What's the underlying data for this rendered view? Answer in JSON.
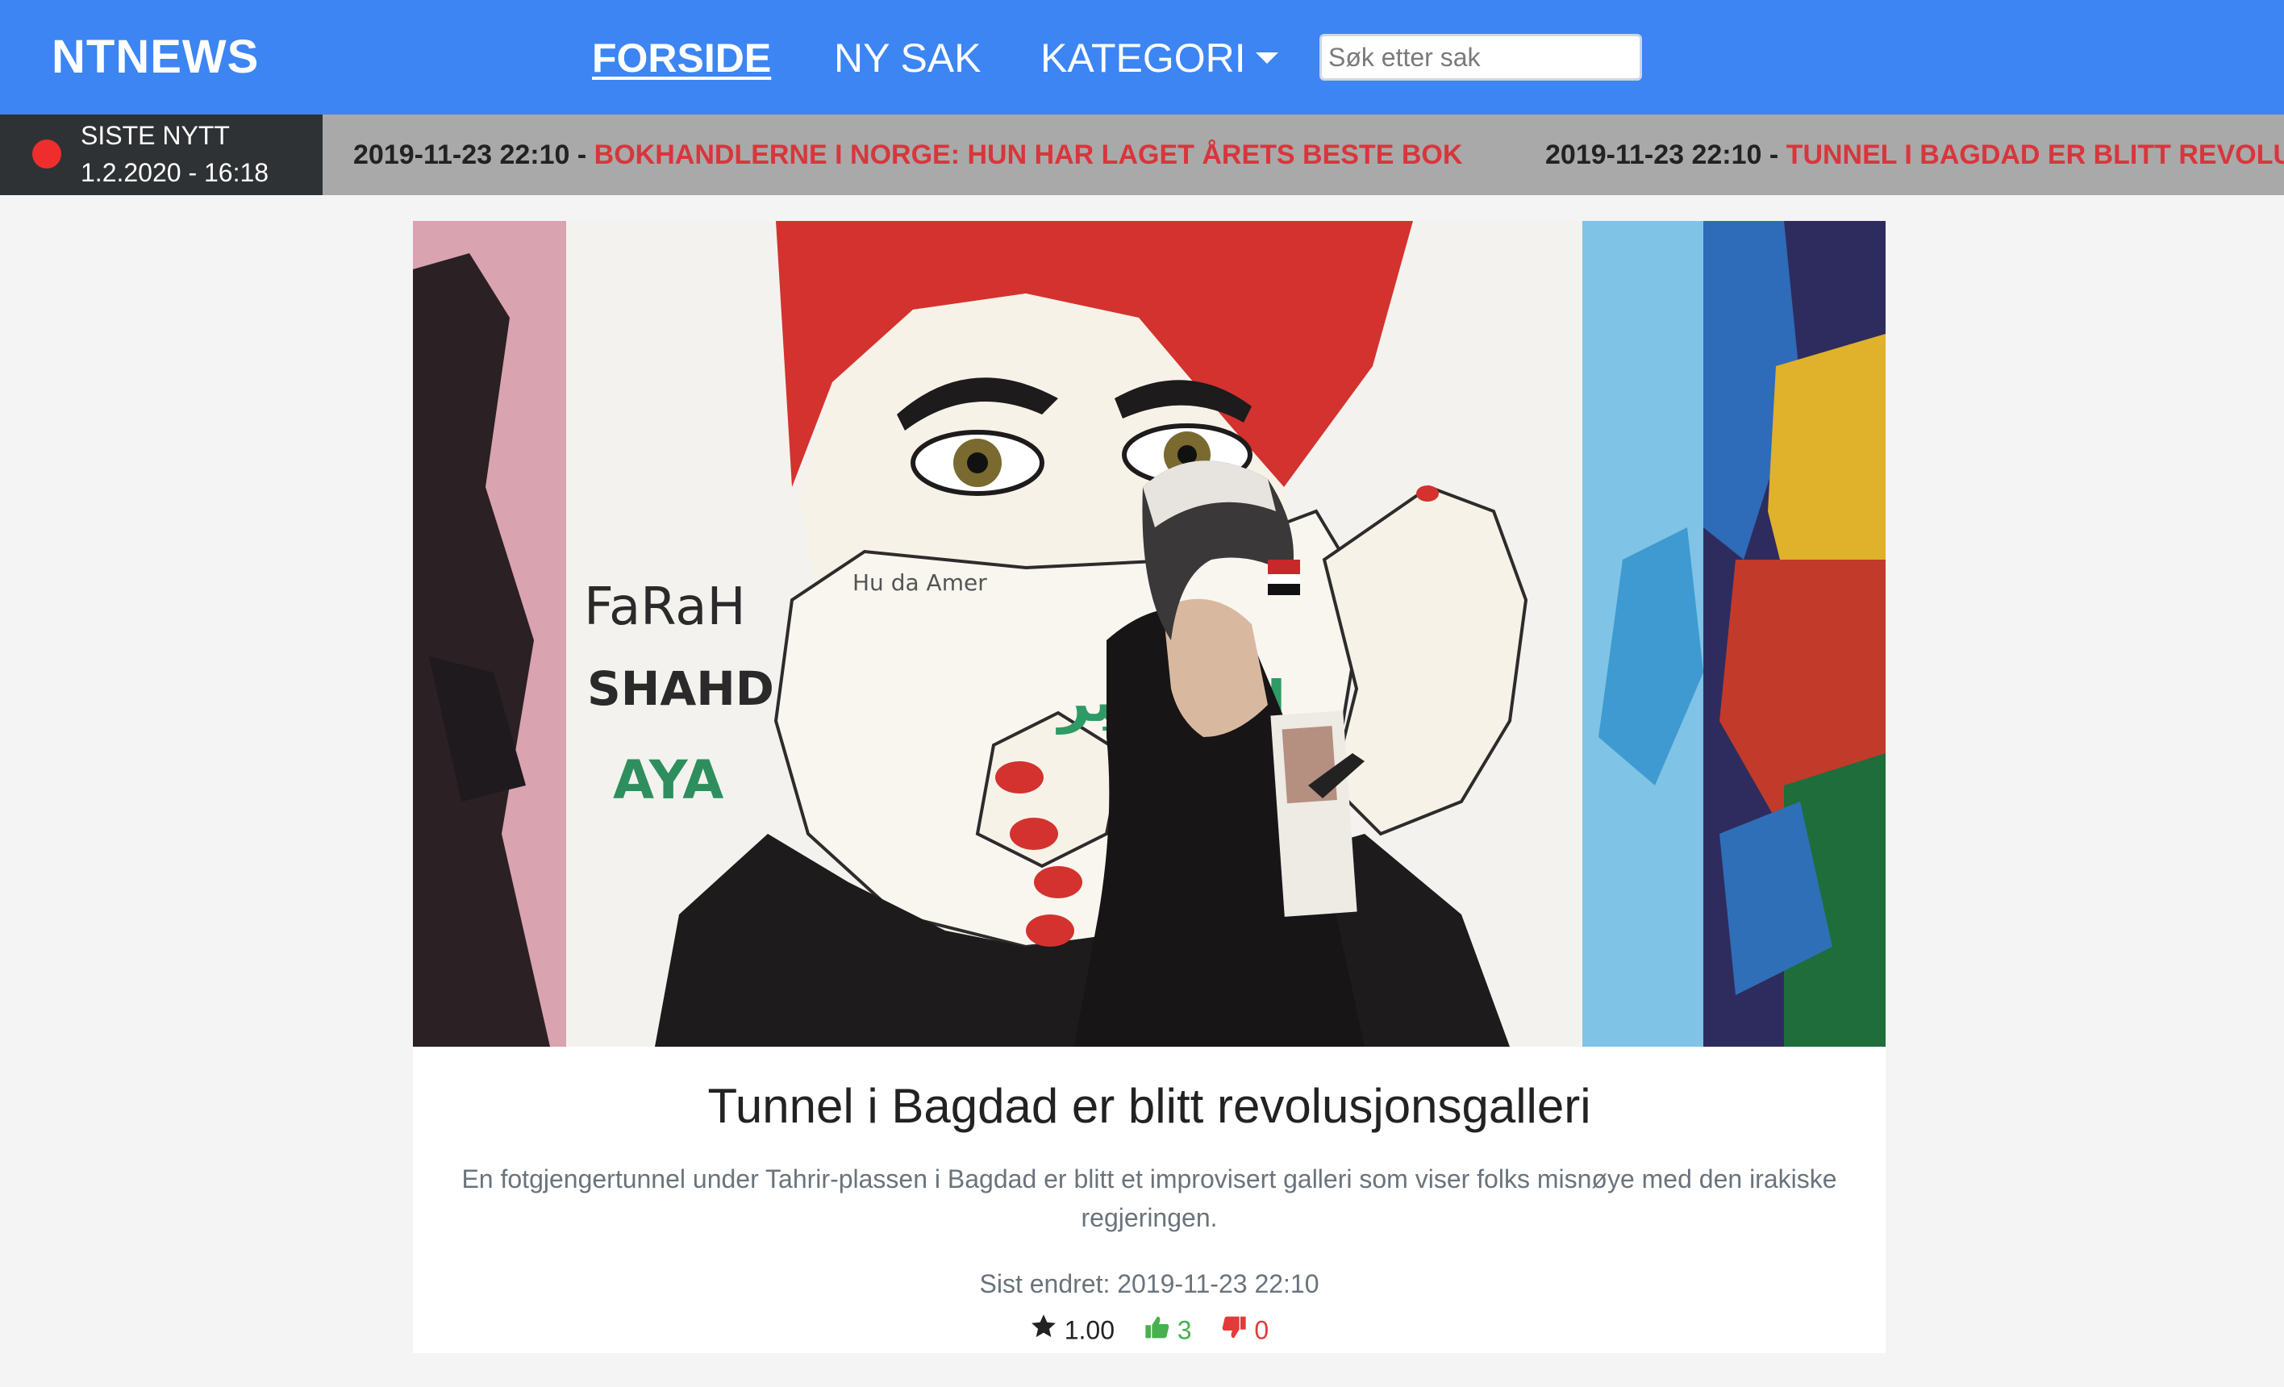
{
  "navbar": {
    "brand": "NTNEWS",
    "links": [
      {
        "label": "FORSIDE",
        "active": true
      },
      {
        "label": "NY SAK",
        "active": false
      },
      {
        "label": "KATEGORI",
        "active": false,
        "dropdown": true
      }
    ],
    "search_placeholder": "Søk etter sak",
    "colors": {
      "background": "#3c85f3",
      "text": "#ffffff"
    }
  },
  "ticker": {
    "label": "SISTE NYTT",
    "time": "1.2.2020 - 16:18",
    "items": [
      {
        "timestamp": "2019-11-23 22:10",
        "separator": " - ",
        "headline": "BOKHANDLERNE I NORGE: HUN HAR LAGET ÅRETS BESTE BOK"
      },
      {
        "timestamp": "2019-11-23 22:10",
        "separator": " - ",
        "headline": "TUNNEL I BAGDAD ER BLITT REVOLUSJONSGALLERI"
      }
    ],
    "colors": {
      "background": "#a9a9a9",
      "badge": "#2f3234",
      "dot": "#f02d2d",
      "headline": "#d8363c"
    }
  },
  "article": {
    "image_text": {
      "names": [
        "FaRaH",
        "SHAHD",
        "AYA"
      ],
      "signature": "Hu da Amer",
      "arabic": "الله أكبر"
    },
    "title": "Tunnel i Bagdad er blitt revolusjonsgalleri",
    "lede": "En fotgjengertunnel under Tahrir-plassen i Bagdad er blitt et improvisert galleri som viser folks misnøye med den irakiske regjeringen.",
    "modified": "Sist endret: 2019-11-23 22:10",
    "rating": "1.00",
    "upvotes": "3",
    "downvotes": "0",
    "icons": {
      "rating": "star-icon",
      "up": "thumbs-up-icon",
      "down": "thumbs-down-icon"
    },
    "colors": {
      "up": "#47b14f",
      "down": "#e33a3a"
    }
  }
}
